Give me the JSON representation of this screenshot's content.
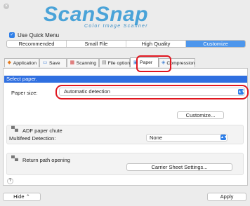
{
  "window": {
    "close_glyph": "×"
  },
  "logo": {
    "main": "ScanSnap",
    "sub": "Color Image Scanner"
  },
  "quick_menu": {
    "label": "Use Quick Menu",
    "checked": true,
    "check_glyph": "✓"
  },
  "profiles": {
    "items": [
      "Recommended",
      "Small File",
      "High Quality",
      "Customize"
    ],
    "selected": "Customize"
  },
  "tabs": [
    {
      "label": "Application",
      "icon": "application-icon",
      "glyph": "◆"
    },
    {
      "label": "Save",
      "icon": "save-folder-icon",
      "glyph": "▭"
    },
    {
      "label": "Scanning",
      "icon": "scanning-icon",
      "glyph": "▦"
    },
    {
      "label": "File option",
      "icon": "file-option-icon",
      "glyph": "▤"
    },
    {
      "label": "Paper",
      "icon": "paper-icon",
      "glyph": "▣"
    },
    {
      "label": "Compression",
      "icon": "compression-icon",
      "glyph": "◈"
    }
  ],
  "active_tab": "Paper",
  "section": {
    "title": "Select paper."
  },
  "paper_size": {
    "label": "Paper size:",
    "value": "Automatic detection"
  },
  "customize_button": "Customize...",
  "adf": {
    "title": "ADF paper chute",
    "multifeed_label": "Multifeed Detection:",
    "multifeed_value": "None"
  },
  "return_path": {
    "title": "Return path opening",
    "carrier_button": "Carrier Sheet Settings..."
  },
  "help": "?",
  "footer": {
    "hide": "Hide ⌃",
    "apply": "Apply"
  },
  "colors": {
    "accent": "#2f6fe0",
    "highlight": "#e0161f",
    "logo": "#4aa3d8"
  }
}
